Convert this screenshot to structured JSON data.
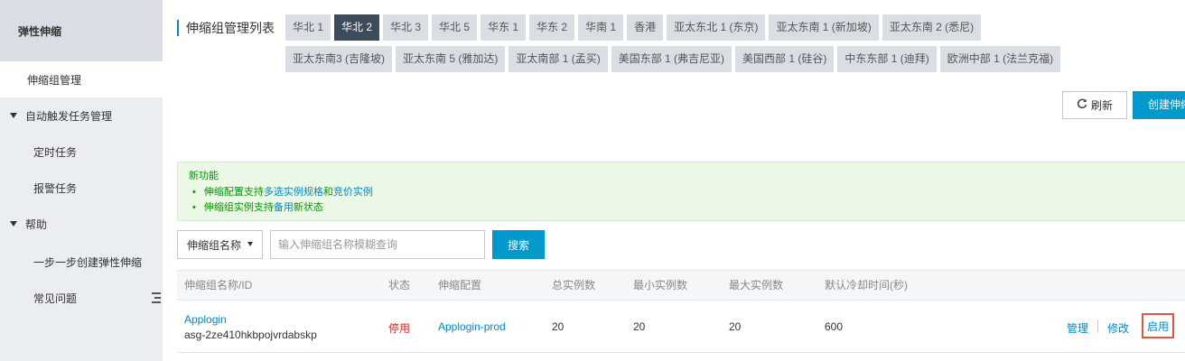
{
  "sidebar": {
    "title": "弹性伸缩",
    "items": [
      {
        "label": "伸缩组管理"
      },
      {
        "label": "自动触发任务管理"
      },
      {
        "label": "定时任务"
      },
      {
        "label": "报警任务"
      },
      {
        "label": "帮助"
      },
      {
        "label": "一步一步创建弹性伸缩"
      },
      {
        "label": "常见问题"
      }
    ]
  },
  "header": {
    "title": "伸缩组管理列表",
    "regions": [
      {
        "label": "华北 1",
        "active": false
      },
      {
        "label": "华北 2",
        "active": true
      },
      {
        "label": "华北 3",
        "active": false
      },
      {
        "label": "华北 5",
        "active": false
      },
      {
        "label": "华东 1",
        "active": false
      },
      {
        "label": "华东 2",
        "active": false
      },
      {
        "label": "华南 1",
        "active": false
      },
      {
        "label": "香港",
        "active": false
      },
      {
        "label": "亚太东北 1 (东京)",
        "active": false
      },
      {
        "label": "亚太东南 1 (新加坡)",
        "active": false
      },
      {
        "label": "亚太东南 2 (悉尼)",
        "active": false
      },
      {
        "label": "亚太东南3 (吉隆坡)",
        "active": false
      },
      {
        "label": "亚太东南 5 (雅加达)",
        "active": false
      },
      {
        "label": "亚太南部 1 (孟买)",
        "active": false
      },
      {
        "label": "美国东部 1 (弗吉尼亚)",
        "active": false
      },
      {
        "label": "美国西部 1 (硅谷)",
        "active": false
      },
      {
        "label": "中东东部 1 (迪拜)",
        "active": false
      },
      {
        "label": "欧洲中部 1 (法兰克福)",
        "active": false
      }
    ]
  },
  "toolbar": {
    "refresh_label": "刷新",
    "refresh_icon": "refresh-icon",
    "create_label": "创建伸缩组"
  },
  "notice": {
    "title": "新功能",
    "line1_a": "伸缩配置支持",
    "line1_link1": "多选实例规格",
    "line1_b": "和",
    "line1_link2": "竞价实例",
    "line2_a": "伸缩组实例支持",
    "line2_link": "备用",
    "line2_b": "新状态"
  },
  "search": {
    "field_label": "伸缩组名称",
    "placeholder": "输入伸缩组名称模糊查询",
    "button_label": "搜索"
  },
  "table": {
    "columns": [
      "伸缩组名称/ID",
      "状态",
      "伸缩配置",
      "总实例数",
      "最小实例数",
      "最大实例数",
      "默认冷却时间(秒)"
    ],
    "rows": [
      {
        "name": "Applogin",
        "id": "asg-2ze410hkbpojvrdabskp",
        "status": "停用",
        "config": "Applogin-prod",
        "total": "20",
        "min": "20",
        "max": "20",
        "cooldown": "600",
        "actions": {
          "manage": "管理",
          "edit": "修改",
          "enable": "启用"
        }
      }
    ]
  },
  "colors": {
    "accent": "#0099cc",
    "link": "#0088cc",
    "active_region": "#3d4b5a",
    "status_stopped": "#e02020",
    "highlight_box": "#e5543e",
    "notice_bg": "#eaf8e5"
  }
}
